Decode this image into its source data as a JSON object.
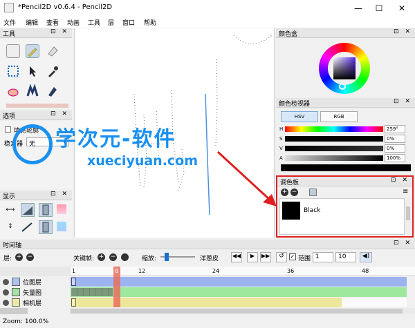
{
  "window": {
    "title": "*Pencil2D v0.6.4 - Pencil2D",
    "minimize": "—",
    "maximize": "☐",
    "close": "✕"
  },
  "menu": [
    "文件",
    "编辑",
    "查看",
    "动画",
    "工具",
    "层",
    "窗口",
    "帮助"
  ],
  "panels": {
    "tools": "工具",
    "options": "选项",
    "display": "显示",
    "color_wheel": "颜色盒",
    "color_inspector": "颜色检视器",
    "palette": "调色板",
    "timeline": "时间轴",
    "float_close": "⊡ ✕"
  },
  "options": {
    "fill_contour": "填充轮廓",
    "stabilizer_label": "稳定器",
    "stabilizer_value": "无"
  },
  "color_inspector": {
    "tab_hsv": "HSV",
    "tab_rgb": "RGB",
    "rows": [
      {
        "label": "H",
        "value": "259°"
      },
      {
        "label": "S",
        "value": "0%"
      },
      {
        "label": "V",
        "value": "0%"
      },
      {
        "label": "A",
        "value": "100%"
      }
    ]
  },
  "palette": {
    "items": [
      {
        "name": "Black",
        "color": "#000000"
      }
    ]
  },
  "timeline": {
    "layers_label": "层:",
    "keyframe_label": "关键帧:",
    "zoom_label": "缩放:",
    "onion_label": "洋葱皮",
    "range_label": "范围",
    "range_from": "1",
    "range_to": "10",
    "ruler_ticks": [
      "1",
      "12",
      "24",
      "36",
      "48"
    ],
    "current_frame_marker": "8",
    "layers": [
      {
        "name": "位图层",
        "color": "#9bb4f0"
      },
      {
        "name": "矢量图",
        "color": "#9ee89e"
      },
      {
        "name": "相机层",
        "color": "#ece79a"
      }
    ]
  },
  "status": {
    "zoom": "Zoom: 100.0%"
  },
  "watermark": {
    "line1": "学次元-软件",
    "line2": "xueciyuan.com"
  },
  "colors": {
    "accent_red": "#e02020",
    "playhead": "#e87060",
    "watermark_blue": "#1a90f0",
    "current_color": "#000000"
  },
  "icons": [
    "app-icon",
    "bitmap-layer-icon",
    "vector-layer-icon",
    "camera-layer-icon",
    "play-icon",
    "loop-icon",
    "sound-icon"
  ]
}
